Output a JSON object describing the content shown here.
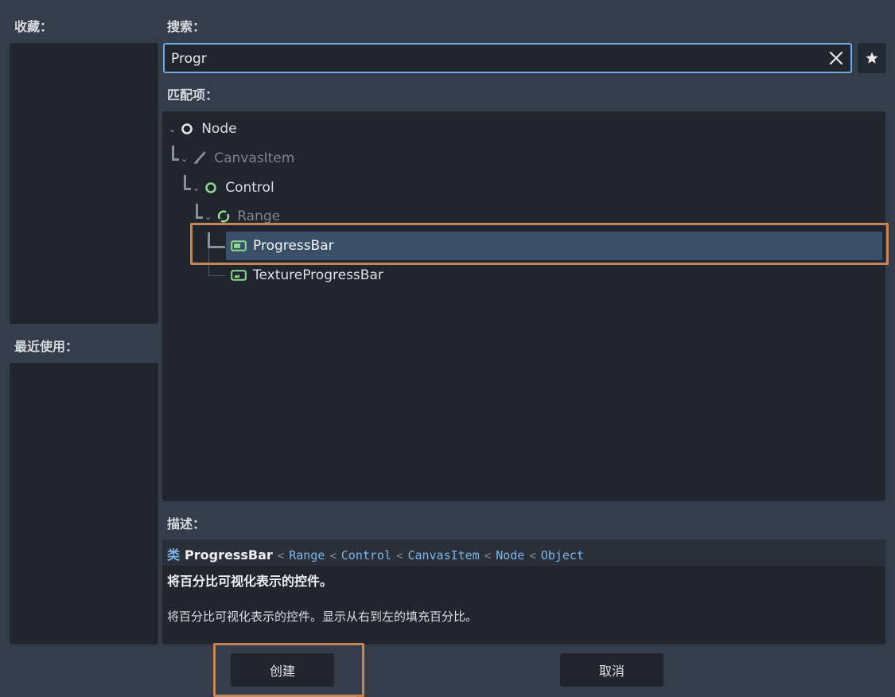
{
  "favorites": {
    "label": "收藏："
  },
  "recent": {
    "label": "最近使用："
  },
  "search": {
    "label": "搜索：",
    "value": "Progr",
    "placeholder": ""
  },
  "matches": {
    "label": "匹配项：",
    "items": [
      {
        "name": "Node",
        "dim": false,
        "icon": "node-circle-icon"
      },
      {
        "name": "CanvasItem",
        "dim": true,
        "icon": "brush-icon"
      },
      {
        "name": "Control",
        "dim": false,
        "icon": "control-circle-icon"
      },
      {
        "name": "Range",
        "dim": true,
        "icon": "range-icon"
      },
      {
        "name": "ProgressBar",
        "dim": false,
        "icon": "progressbar-icon",
        "selected": true
      },
      {
        "name": "TextureProgressBar",
        "dim": false,
        "icon": "texture-progressbar-icon"
      }
    ]
  },
  "description": {
    "label": "描述：",
    "class_prefix": "类",
    "class_name": "ProgressBar",
    "lt": "<",
    "inheritance": [
      "Range",
      "Control",
      "CanvasItem",
      "Node",
      "Object"
    ],
    "brief": "将百分比可视化表示的控件。",
    "full": "将百分比可视化表示的控件。显示从右到左的填充百分比。"
  },
  "buttons": {
    "create": "创建",
    "cancel": "取消"
  },
  "colors": {
    "accent": "#6ea8dc",
    "highlight": "#c4875a",
    "selected_row": "#3a5068",
    "icon_green": "#8eda8e"
  }
}
